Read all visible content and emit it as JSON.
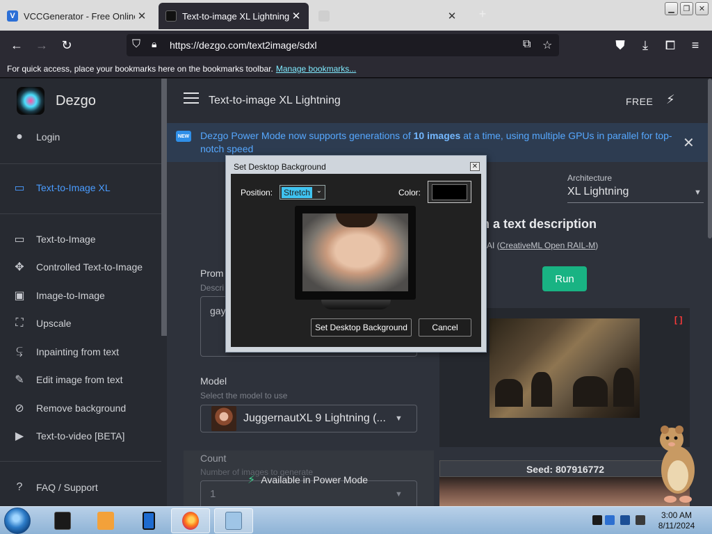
{
  "browser": {
    "tabs": [
      {
        "title": "VCCGenerator - Free Online Cr",
        "favicon": "v-logo-icon"
      },
      {
        "title": "Text-to-image XL Lightning - AI",
        "favicon": "dezgo-icon"
      },
      {
        "title": "",
        "favicon": "page-icon"
      }
    ],
    "new_tab": "+",
    "url": "https://dezgo.com/text2image/sdxl",
    "bookmarks_hint": "For quick access, place your bookmarks here on the bookmarks toolbar.",
    "bookmarks_link": "Manage bookmarks..."
  },
  "site": {
    "brand": "Dezgo",
    "login": "Login",
    "active_item": "Text-to-Image XL",
    "sidebar_items": [
      {
        "label": "Text-to-Image",
        "icon": "chat-bubble-icon"
      },
      {
        "label": "Controlled Text-to-Image",
        "icon": "move-arrows-icon"
      },
      {
        "label": "Image-to-Image",
        "icon": "image-icon"
      },
      {
        "label": "Upscale",
        "icon": "expand-icon"
      },
      {
        "label": "Inpainting from text",
        "icon": "wrap-text-icon"
      },
      {
        "label": "Edit image from text",
        "icon": "edit-note-icon"
      },
      {
        "label": "Remove background",
        "icon": "no-image-icon"
      },
      {
        "label": "Text-to-video [BETA]",
        "icon": "video-camera-icon"
      }
    ],
    "faq": "FAQ / Support",
    "page_title": "Text-to-image XL Lightning",
    "plan": "FREE",
    "notice": {
      "badge": "NEW",
      "text_before": "Dezgo Power Mode now supports generations of ",
      "text_bold": "10 images",
      "text_after": " at a time, using multiple GPUs in parallel for top-notch speed"
    },
    "architecture": {
      "label": "Architecture",
      "value": "XL Lightning"
    },
    "hero_title": "m a text description",
    "license_prefix": "AI (",
    "license_link": "CreativeML Open RAIL-M",
    "license_suffix": ")",
    "run": "Run",
    "prompt": {
      "label": "Prom",
      "help": "Descri",
      "value": "gay"
    },
    "model": {
      "label": "Model",
      "help": "Select the model to use",
      "value": "JuggernautXL 9 Lightning (..."
    },
    "count": {
      "label": "Count",
      "help": "Number of images to generate",
      "value": "1"
    },
    "power_mode": "Available in Power Mode",
    "seed": "Seed: 807916772"
  },
  "dialog": {
    "title": "Set Desktop Background",
    "position_label": "Position:",
    "position_value": "Stretch",
    "color_label": "Color:",
    "color_value": "#000000",
    "set_button": "Set Desktop Background",
    "cancel_button": "Cancel"
  },
  "taskbar": {
    "time": "3:00 AM",
    "date": "8/11/2024",
    "apps": [
      "terminal-app-icon",
      "media-player-icon",
      "tablet-app-icon",
      "firefox-icon",
      "notepad-icon"
    ]
  },
  "colors": {
    "accent_blue": "#4a9cff",
    "run_green": "#19b383",
    "sidebar_bg": "#272a31",
    "main_bg": "#2e323b"
  }
}
